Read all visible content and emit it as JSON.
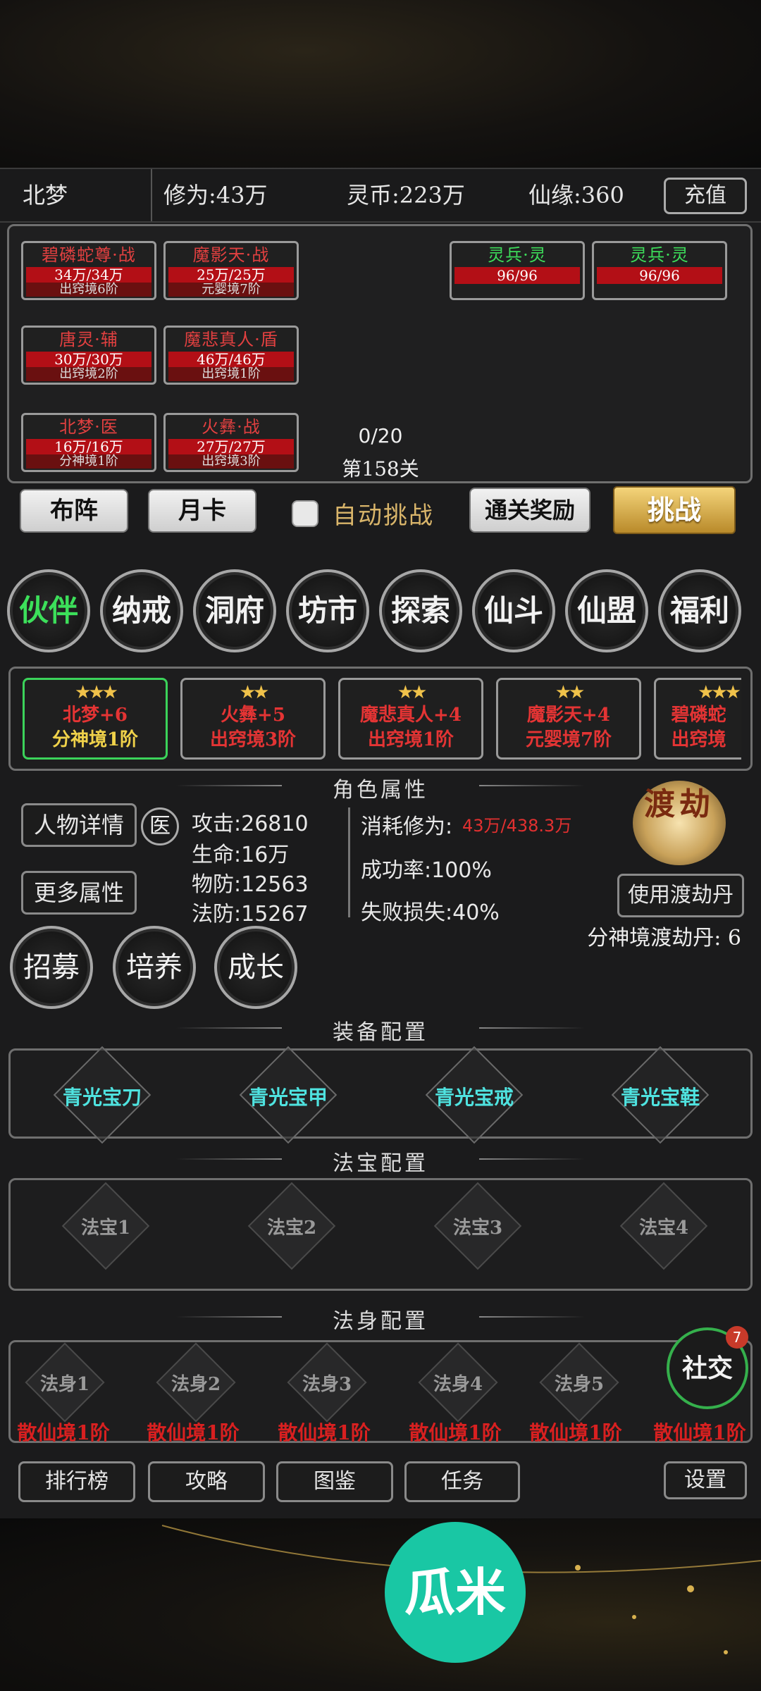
{
  "topbar": {
    "player_name": "北梦",
    "cultivation": "修为:43万",
    "spirit_coins": "灵币:223万",
    "fate": "仙缘:360",
    "recharge_label": "充值"
  },
  "team": {
    "units": [
      {
        "name": "碧磷蛇尊·战",
        "hp": "34万/34万",
        "rank": "出窍境6阶"
      },
      {
        "name": "魔影天·战",
        "hp": "25万/25万",
        "rank": "元婴境7阶"
      },
      {
        "name": "唐灵·辅",
        "hp": "30万/30万",
        "rank": "出窍境2阶"
      },
      {
        "name": "魔悲真人·盾",
        "hp": "46万/46万",
        "rank": "出窍境1阶"
      },
      {
        "name": "北梦·医",
        "hp": "16万/16万",
        "rank": "分神境1阶"
      },
      {
        "name": "火彝·战",
        "hp": "27万/27万",
        "rank": "出窍境3阶"
      }
    ],
    "enemies": [
      {
        "name": "灵兵·灵",
        "hp": "96/96"
      },
      {
        "name": "灵兵·灵",
        "hp": "96/96"
      }
    ],
    "wave": "0/20",
    "stage": "第158关"
  },
  "actions": {
    "formation": "布阵",
    "month_card": "月卡",
    "auto_challenge": "自动挑战",
    "clear_reward": "通关奖励",
    "challenge": "挑战"
  },
  "nav": [
    "伙伴",
    "纳戒",
    "洞府",
    "坊市",
    "探索",
    "仙斗",
    "仙盟",
    "福利"
  ],
  "partners": [
    {
      "stars": "★★★",
      "name": "北梦+6",
      "rank": "分神境1阶",
      "selected": true
    },
    {
      "stars": "★★",
      "name": "火彝+5",
      "rank": "出窍境3阶"
    },
    {
      "stars": "★★",
      "name": "魔悲真人+4",
      "rank": "出窍境1阶"
    },
    {
      "stars": "★★",
      "name": "魔影天+4",
      "rank": "元婴境7阶"
    },
    {
      "stars": "★★★",
      "name": "碧磷蛇",
      "rank": "出窍境"
    }
  ],
  "attributes": {
    "section_title": "角色属性",
    "details_button": "人物详情",
    "class_badge": "医",
    "more_button": "更多属性",
    "attack": "攻击:26810",
    "life": "生命:16万",
    "phys_def": "物防:12563",
    "magic_def": "法防:15267",
    "cost_label": "消耗修为:",
    "cost_value": "43万/438.3万",
    "success": "成功率:100%",
    "fail_loss": "失败损失:40%",
    "tribulation_icon": "渡劫",
    "use_pill": "使用渡劫丹",
    "pill_count": "分神境渡劫丹: 6"
  },
  "recruit": [
    "招募",
    "培养",
    "成长"
  ],
  "equipment": {
    "section_title": "装备配置",
    "items": [
      "青光宝刀",
      "青光宝甲",
      "青光宝戒",
      "青光宝鞋"
    ]
  },
  "treasures": {
    "section_title": "法宝配置",
    "slots": [
      "法宝1",
      "法宝2",
      "法宝3",
      "法宝4"
    ]
  },
  "bodies": {
    "section_title": "法身配置",
    "slots": [
      "法身1",
      "法身2",
      "法身3",
      "法身4",
      "法身5"
    ],
    "ranks": [
      "散仙境1阶",
      "散仙境1阶",
      "散仙境1阶",
      "散仙境1阶",
      "散仙境1阶",
      "散仙境1阶"
    ]
  },
  "social": {
    "label": "社交",
    "badge": "7"
  },
  "bottom": {
    "ranking": "排行榜",
    "guide": "攻略",
    "atlas": "图鉴",
    "tasks": "任务",
    "settings": "设置"
  },
  "logo_text": "瓜米"
}
